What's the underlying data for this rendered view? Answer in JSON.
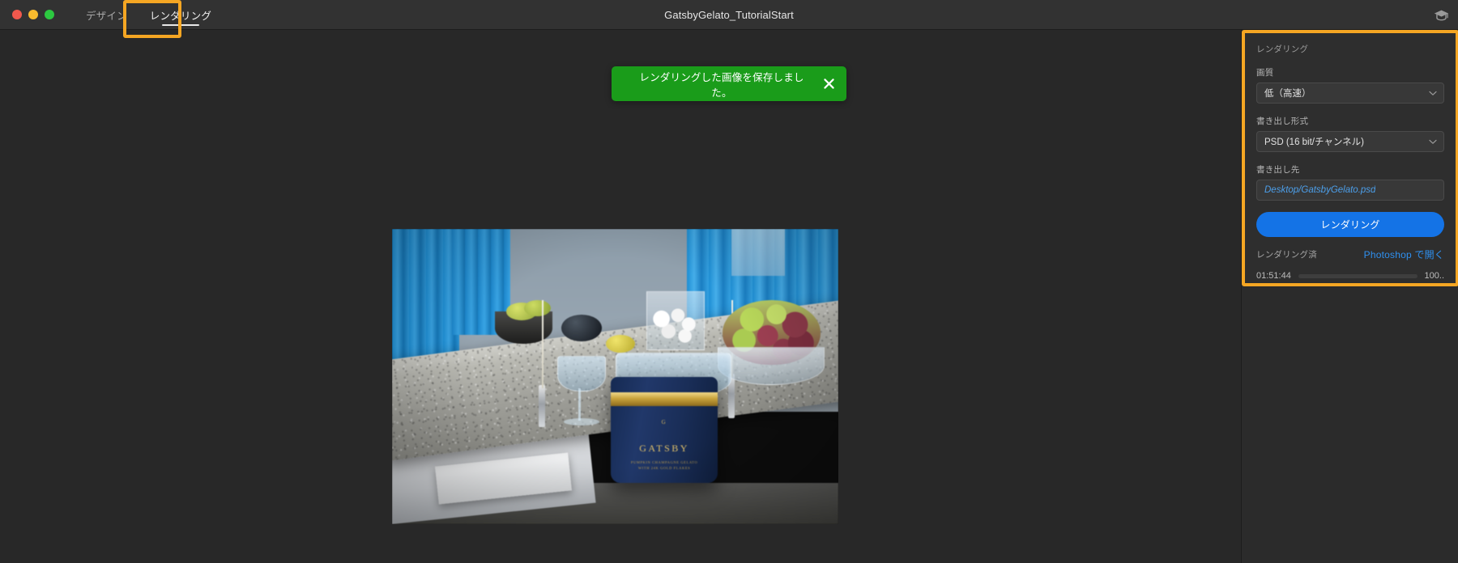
{
  "window": {
    "title": "GatsbyGelato_TutorialStart",
    "traffic_lights": [
      "close",
      "minimize",
      "zoom"
    ],
    "colors": {
      "close": "#f1584d",
      "minimize": "#f8bb2e",
      "zoom": "#2cc840",
      "accent_blue": "#1473e6",
      "link_blue": "#2f90f0",
      "toast_green": "#1a9c1a",
      "callout_orange": "#f5a623",
      "titlebar_bg": "#323232",
      "canvas_bg": "#282828",
      "panel_bg": "#2e2e2e"
    }
  },
  "tabs": [
    {
      "label": "デザイン",
      "active": false
    },
    {
      "label": "レンダリング",
      "active": true
    }
  ],
  "toolbar": {
    "learn_icon": "graduation-cap-icon"
  },
  "toast": {
    "message": "レンダリングした画像を保存しました。",
    "close_icon": "close-icon"
  },
  "canvas": {
    "rendered_scene_alt": "GATSBY gelato tub on a kitchen counter with grapes, glassware and candles",
    "product": {
      "brand": "GATSBY",
      "tagline_line1": "PUMPKIN CHAMPAGNE GELATO",
      "tagline_line2": "WITH 24K GOLD FLAKES",
      "monogram": "G"
    }
  },
  "panel": {
    "title": "レンダリング",
    "quality": {
      "label": "画質",
      "value": "低（高速）",
      "chevron_icon": "chevron-down-icon"
    },
    "format": {
      "label": "書き出し形式",
      "value": "PSD (16 bit/チャンネル)",
      "chevron_icon": "chevron-down-icon"
    },
    "destination": {
      "label": "書き出し先",
      "value": "Desktop/GatsbyGelato.psd"
    },
    "render_button": "レンダリング",
    "status": {
      "label": "レンダリング済",
      "open_link": "Photoshop で開く"
    },
    "progress": {
      "elapsed": "01:51:44",
      "percent_label": "100..",
      "percent_value": 100
    }
  }
}
